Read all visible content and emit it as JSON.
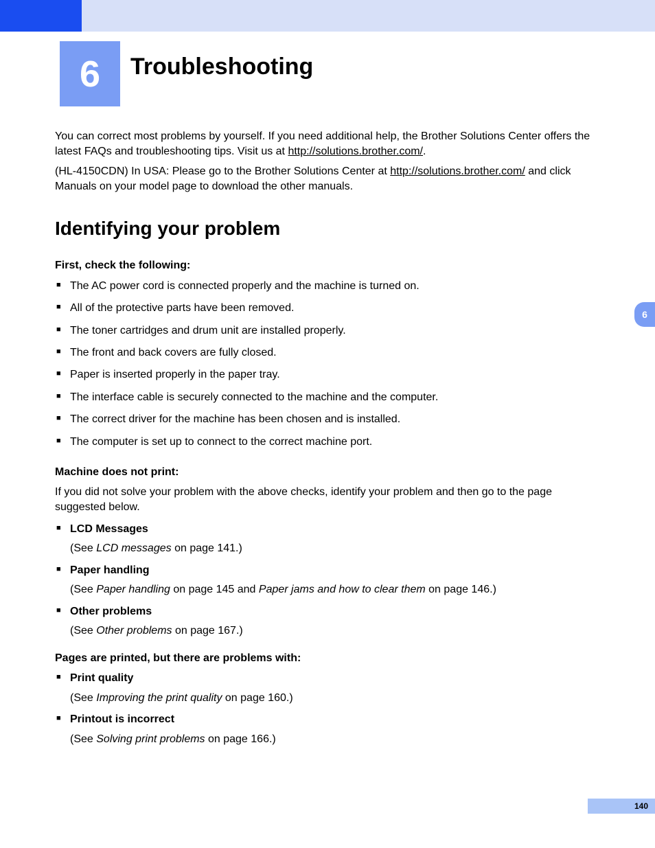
{
  "chapter": {
    "number": "6",
    "title": "Troubleshooting"
  },
  "intro": {
    "p1a": "You can correct most problems by yourself. If you need additional help, the Brother Solutions Center offers the latest FAQs and troubleshooting tips. Visit us at ",
    "link1": "http://solutions.brother.com/",
    "p1b": ".",
    "p2a": "(HL-4150CDN) In USA:  Please go to the Brother Solutions Center at ",
    "link2": "http://solutions.brother.com/",
    "p2b": " and click Manuals on your model page to download the other manuals."
  },
  "section1": {
    "heading": "Identifying your problem",
    "first_check_label": "First, check the following:",
    "checks": [
      "The AC power cord is connected properly and the machine is turned on.",
      "All of the protective parts have been removed.",
      "The toner cartridges and drum unit are installed properly.",
      "The front and back covers are fully closed.",
      "Paper is inserted properly in the paper tray.",
      "The interface cable is securely connected to the machine and the computer.",
      "The correct driver for the machine has been chosen and is installed.",
      "The computer is set up to connect to the correct machine port."
    ],
    "not_print_label": "Machine does not print:",
    "not_print_intro": "If you did not solve your problem with the above checks, identify your problem and then go to the page suggested below.",
    "refs1": [
      {
        "title": "LCD Messages",
        "see_pre": "(See ",
        "see_it": "LCD messages",
        "see_post": " on page 141.)"
      },
      {
        "title": "Paper handling",
        "see_pre": "(See ",
        "see_it": "Paper handling",
        "see_mid": " on page 145 and ",
        "see_it2": "Paper jams and how to clear them",
        "see_post": " on page 146.)"
      },
      {
        "title": "Other problems",
        "see_pre": "(See ",
        "see_it": "Other problems",
        "see_post": " on page 167.)"
      }
    ],
    "printed_but_label": "Pages are printed, but there are problems with:",
    "refs2": [
      {
        "title": "Print quality",
        "see_pre": "(See ",
        "see_it": "Improving the print quality",
        "see_post": " on page 160.)"
      },
      {
        "title": "Printout is incorrect",
        "see_pre": "(See ",
        "see_it": "Solving print problems",
        "see_post": " on page 166.)"
      }
    ]
  },
  "side_tab": "6",
  "page_number": "140"
}
